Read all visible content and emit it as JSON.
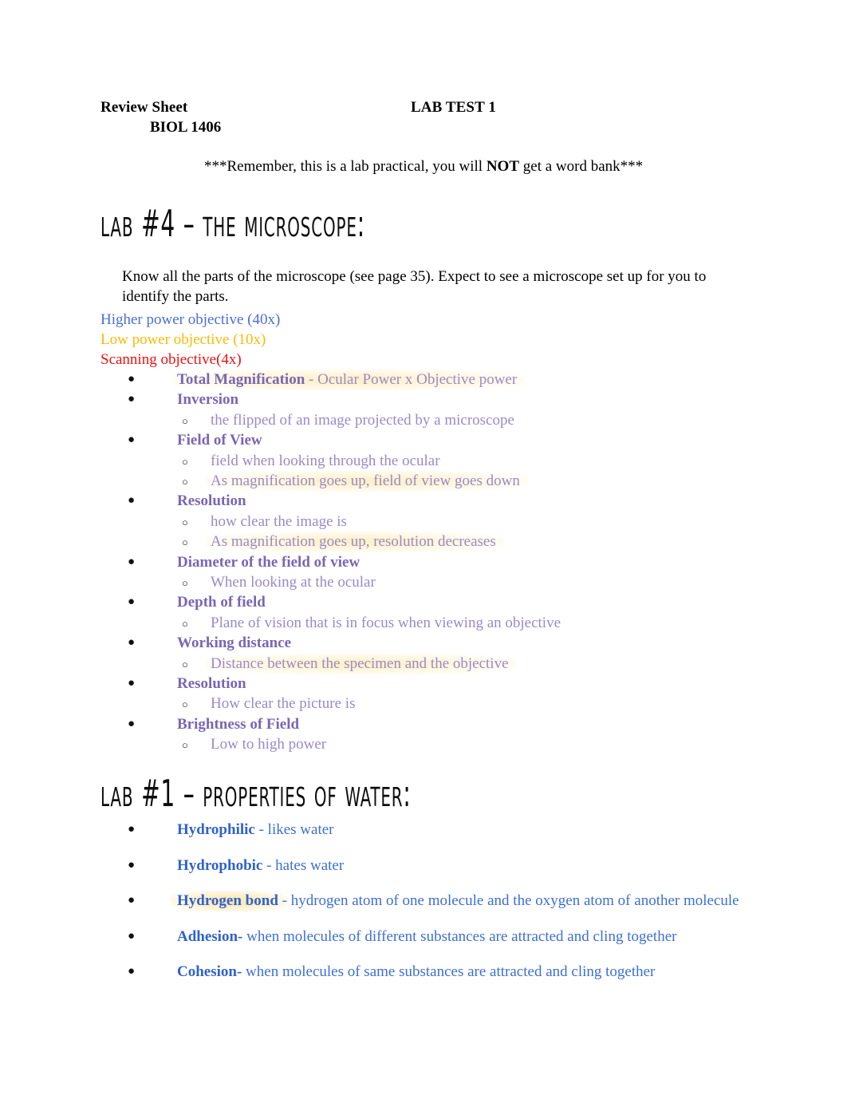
{
  "header": {
    "left_title": "Review Sheet",
    "center_title": "LAB TEST 1",
    "course": "BIOL 1406",
    "note_prefix": "***Remember, this is a lab practical, you will ",
    "note_bold": "NOT",
    "note_suffix": " get a word bank***"
  },
  "colors": {
    "blue_objective": "#4a6fd8",
    "gold_objective": "#fcba03",
    "red_objective": "#ee1111",
    "purple_bold": "#7a66b4",
    "purple_text": "#9a8ac6",
    "blue_bold": "#2f62cf",
    "blue_text": "#3d6fd6",
    "highlight": "#fbeab9"
  },
  "microscope_section": {
    "heading": "Lab #4 – The Microscope:",
    "intro": "Know all the parts of the microscope (see page 35).  Expect to see a microscope set up for you to identify the parts.",
    "objectives": [
      {
        "label": "Higher power objective (40x)",
        "color": "#4a6fd8"
      },
      {
        "label": "Low power objective (10x)",
        "color": "#fcba03"
      },
      {
        "label": "Scanning objective(4x)",
        "color": "#ee1111"
      }
    ],
    "items": [
      {
        "term": "Total Magnification",
        "dash": " -  ",
        "detail": "Ocular Power x Objective power",
        "highlight": true
      },
      {
        "term": "Inversion",
        "dash": "",
        "detail": "",
        "highlight": false
      },
      {
        "sub": "the flipped of an image projected by a microscope",
        "highlight": false
      },
      {
        "term": "Field of View",
        "dash": "",
        "detail": "",
        "highlight": false
      },
      {
        "sub": "field when looking through the ocular",
        "highlight": false
      },
      {
        "sub": "As magnification goes up, field of view goes down",
        "highlight": true
      },
      {
        "term": "Resolution",
        "dash": "",
        "detail": "",
        "highlight": false
      },
      {
        "sub": "how clear the image is",
        "highlight": false
      },
      {
        "sub": "As magnification goes up, resolution decreases",
        "highlight": true
      },
      {
        "term": "Diameter of the field of view",
        "dash": "",
        "detail": "",
        "highlight": false
      },
      {
        "sub": " When looking at the ocular",
        "highlight": false
      },
      {
        "term": "Depth of field",
        "dash": "",
        "detail": "",
        "highlight": false
      },
      {
        "sub": "Plane of vision that is in focus when viewing an objective",
        "highlight": false
      },
      {
        "term": "Working distance",
        "dash": "",
        "detail": "",
        "highlight": false
      },
      {
        "sub": "Distance between the specimen and the objective",
        "highlight": true
      },
      {
        "term": "Resolution",
        "dash": "",
        "detail": "",
        "highlight": false
      },
      {
        "sub": "How clear the picture is",
        "highlight": false
      },
      {
        "term": "Brightness of Field",
        "dash": "",
        "detail": "",
        "highlight": false
      },
      {
        "sub": "Low to high power",
        "highlight": false
      }
    ]
  },
  "water_section": {
    "heading": "Lab #1 – Properties of Water:",
    "items": [
      {
        "term": "Hydrophilic",
        "detail": " - likes water",
        "highlight": false
      },
      {
        "term": "Hydrophobic",
        "detail": " - hates water",
        "highlight": false
      },
      {
        "term": "Hydrogen bond",
        "detail": " - hydrogen atom of one molecule and the oxygen atom of another molecule",
        "highlight": true
      },
      {
        "term": "Adhesion-",
        "detail": " when molecules of different substances are attracted and cling together",
        "highlight": false
      },
      {
        "term": "Cohesion-",
        "detail": " when molecules of same substances are attracted and cling together",
        "highlight": false
      }
    ]
  },
  "icons": {
    "bullet_filled": "●",
    "bullet_hollow": "○"
  }
}
